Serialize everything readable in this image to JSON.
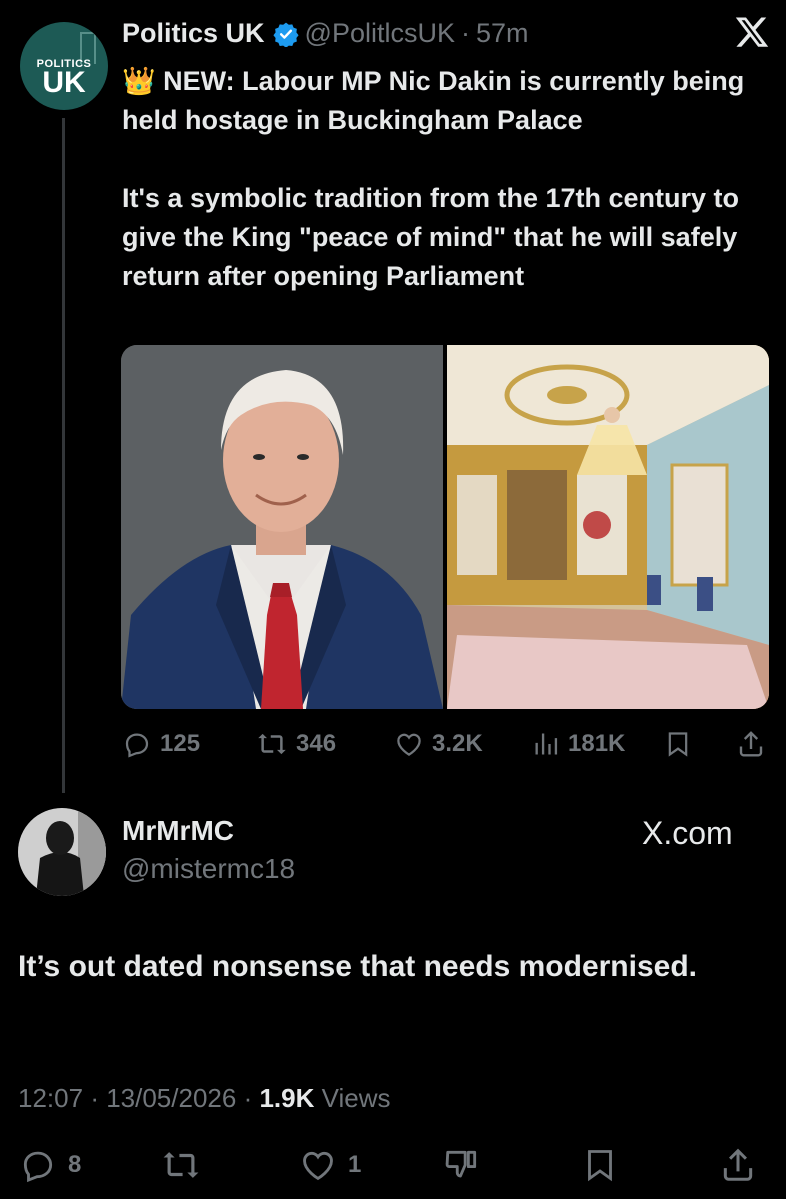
{
  "tweet": {
    "author_name": "Politics UK",
    "handle": "@PolitlcsUK",
    "separator": "·",
    "age": "57m",
    "avatar_text_small": "POLITICS",
    "avatar_text_big": "UK",
    "text_line1": "NEW: Labour MP Nic Dakin is currently being held hostage in Buckingham Palace",
    "text_line2": "It's a symbolic tradition from the 17th century to give the King \"peace of mind\" that he will safely return after opening Parliament",
    "emoji": "👑",
    "images": [
      "portrait-photo",
      "palace-room-photo"
    ],
    "stats": {
      "replies": "125",
      "reposts": "346",
      "likes": "3.2K",
      "views": "181K"
    },
    "icons": [
      "reply-icon",
      "repost-icon",
      "like-icon",
      "views-icon",
      "bookmark-icon",
      "share-icon"
    ],
    "colors": {
      "verified_badge": "#1d9bf0",
      "background": "#000000",
      "muted": "#71767b"
    }
  },
  "reply": {
    "author_name": "MrMrMC",
    "handle": "@mistermc18",
    "watermark": "X.com",
    "text": "It’s out dated nonsense that needs modernised.",
    "time": "12:07",
    "date": "13/05/2026",
    "views_count": "1.9K",
    "views_label": "Views",
    "stats": {
      "replies": "8",
      "likes": "1"
    },
    "icons": [
      "reply-icon",
      "repost-icon",
      "like-icon",
      "dislike-icon",
      "bookmark-icon",
      "share-icon"
    ]
  }
}
